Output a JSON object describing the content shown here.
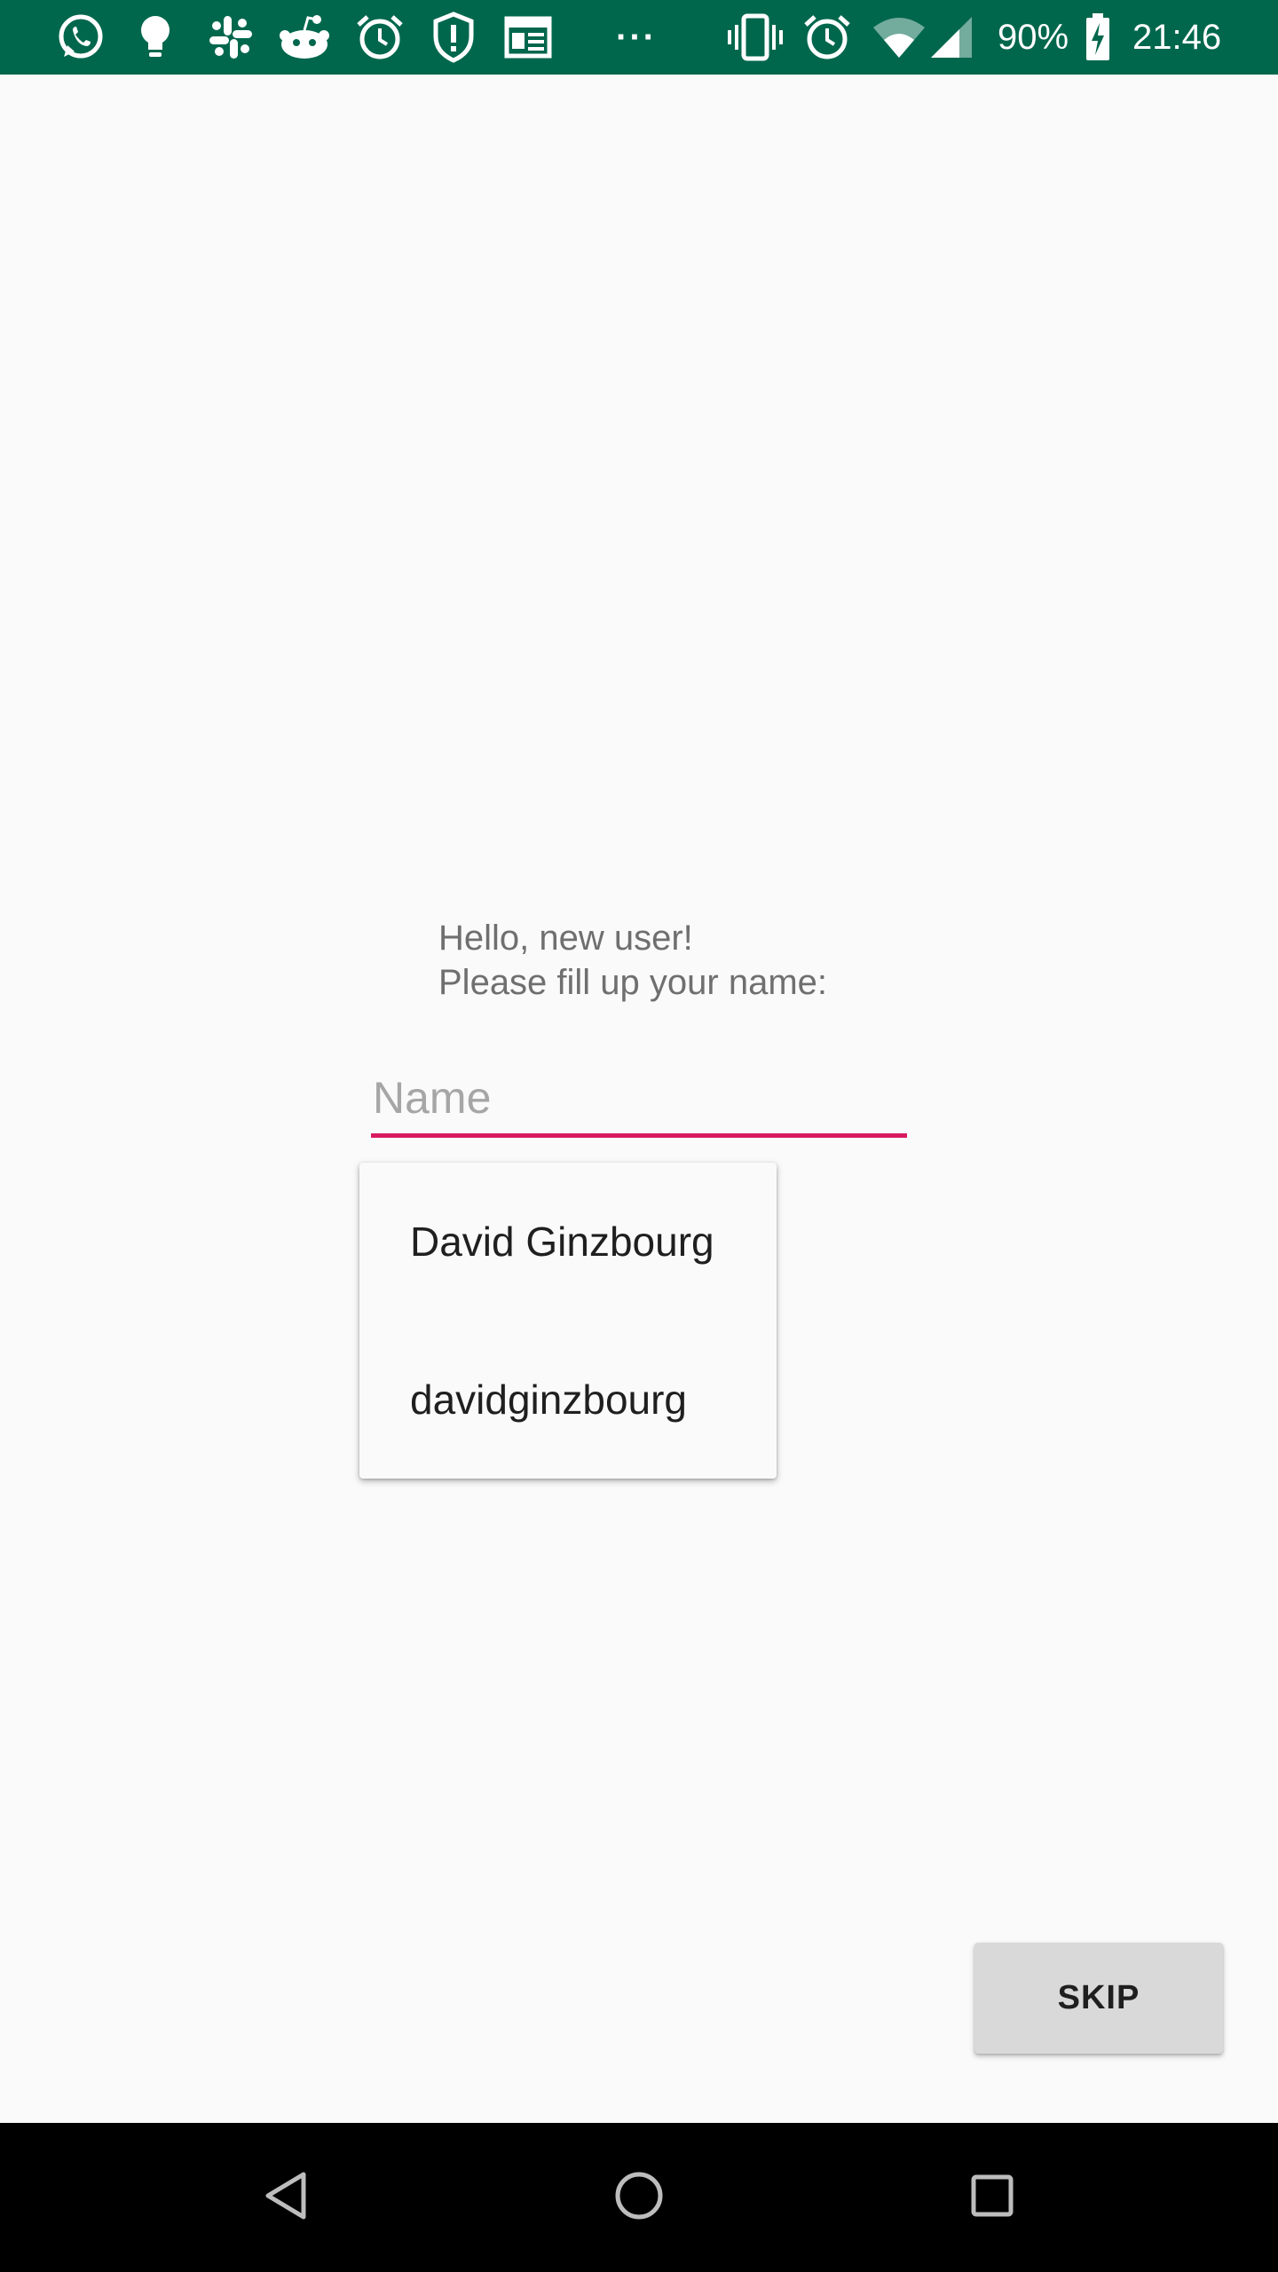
{
  "status_bar": {
    "battery": "90%",
    "time": "21:46",
    "more_indicator": "···",
    "left_icons": [
      "whatsapp-icon",
      "lightbulb-icon",
      "slack-icon",
      "reddit-icon",
      "alarm-icon",
      "shield-icon",
      "calendar-icon"
    ],
    "right_icons": [
      "vibrate-icon",
      "alarm-icon",
      "wifi-icon",
      "signal-icon",
      "battery-icon"
    ]
  },
  "greeting": {
    "line1": "Hello, new user!",
    "line2": "Please fill up your name:"
  },
  "name_field": {
    "placeholder": "Name",
    "value": ""
  },
  "suggestions": [
    "David Ginzbourg",
    "davidginzbourg"
  ],
  "skip_button": {
    "label": "SKIP"
  },
  "nav_bar": {
    "icons": [
      "back-icon",
      "home-icon",
      "recents-icon"
    ]
  },
  "colors": {
    "status_bar": "#00674d",
    "accent": "#d81b60",
    "background": "#fafafa",
    "button": "#d9d9d9"
  }
}
